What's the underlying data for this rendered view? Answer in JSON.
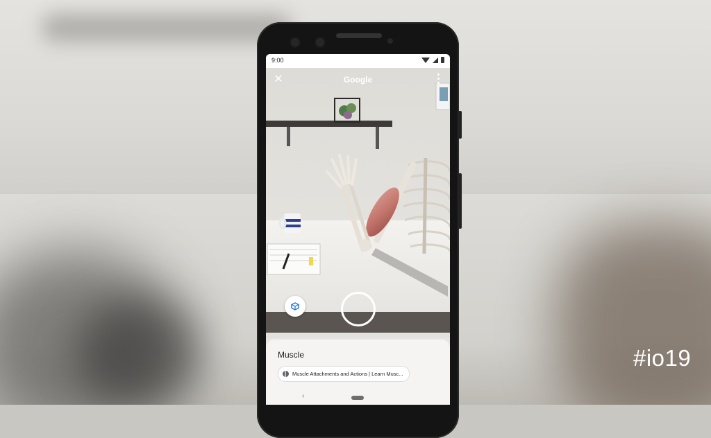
{
  "event": {
    "hashtag": "#io19"
  },
  "status_bar": {
    "time": "9:00",
    "icons": [
      "wifi-icon",
      "signal-icon",
      "battery-icon"
    ]
  },
  "top_bar": {
    "title": "Google",
    "icons": [
      "close-icon",
      "overflow-menu-icon"
    ]
  },
  "camera": {
    "controls": [
      "view-in-3d-icon",
      "shutter-button"
    ]
  },
  "result_sheet": {
    "title": "Muscle",
    "source_chip_label": "Muscle Attachments and Actions | Learn Musc..."
  },
  "nav_bar": {
    "icons": [
      "back-icon",
      "home-pill"
    ]
  },
  "colors": {
    "sheet_background": "#f5f4f2",
    "muscle": "#c4766d",
    "bone": "#e8e3da",
    "phone_body": "#141414"
  }
}
